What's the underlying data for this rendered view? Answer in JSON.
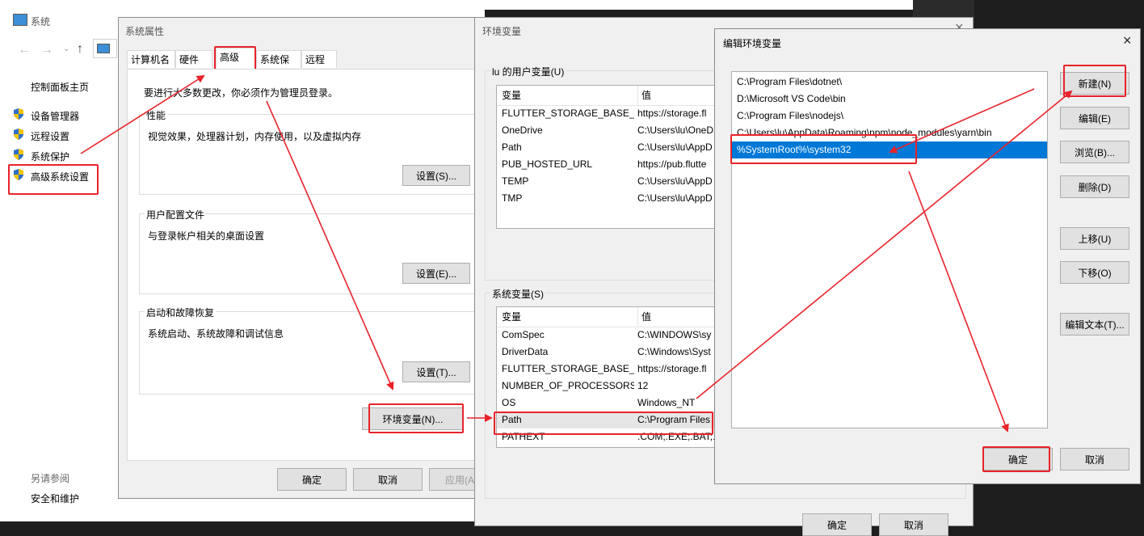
{
  "system_window": {
    "title": "系统",
    "nav_links": {
      "control_panel_home": "控制面板主页",
      "device_manager": "设备管理器",
      "remote_settings": "远程设置",
      "system_protection": "系统保护",
      "advanced_system_settings": "高级系统设置"
    },
    "see_also_label": "另请参阅",
    "security_maintenance": "安全和维护"
  },
  "sys_props": {
    "title": "系统属性",
    "tabs": [
      "计算机名",
      "硬件",
      "高级",
      "系统保护",
      "远程"
    ],
    "admin_note": "要进行大多数更改，你必须作为管理员登录。",
    "performance": {
      "label": "性能",
      "desc": "视觉效果，处理器计划，内存使用，以及虚拟内存",
      "button": "设置(S)..."
    },
    "user_profiles": {
      "label": "用户配置文件",
      "desc": "与登录帐户相关的桌面设置",
      "button": "设置(E)..."
    },
    "startup_recovery": {
      "label": "启动和故障恢复",
      "desc": "系统启动、系统故障和调试信息",
      "button": "设置(T)..."
    },
    "env_vars_button": "环境变量(N)...",
    "ok": "确定",
    "cancel": "取消",
    "apply": "应用(A"
  },
  "env_vars": {
    "title": "环境变量",
    "user_section": "lu 的用户变量(U)",
    "system_section": "系统变量(S)",
    "col_var": "变量",
    "col_val": "值",
    "user_rows": [
      {
        "name": "FLUTTER_STORAGE_BASE_...",
        "value": "https://storage.fl"
      },
      {
        "name": "OneDrive",
        "value": "C:\\Users\\lu\\OneD"
      },
      {
        "name": "Path",
        "value": "C:\\Users\\lu\\AppD"
      },
      {
        "name": "PUB_HOSTED_URL",
        "value": "https://pub.flutte"
      },
      {
        "name": "TEMP",
        "value": "C:\\Users\\lu\\AppD"
      },
      {
        "name": "TMP",
        "value": "C:\\Users\\lu\\AppD"
      }
    ],
    "system_rows": [
      {
        "name": "ComSpec",
        "value": "C:\\WINDOWS\\sy"
      },
      {
        "name": "DriverData",
        "value": "C:\\Windows\\Syst"
      },
      {
        "name": "FLUTTER_STORAGE_BASE_...",
        "value": "https://storage.fl"
      },
      {
        "name": "NUMBER_OF_PROCESSORS",
        "value": "12"
      },
      {
        "name": "OS",
        "value": "Windows_NT"
      },
      {
        "name": "Path",
        "value": "C:\\Program Files"
      },
      {
        "name": "PATHEXT",
        "value": ".COM;.EXE;.BAT;."
      }
    ],
    "ok": "确定",
    "cancel": "取消"
  },
  "edit_env": {
    "title": "编辑环境变量",
    "entries": [
      "C:\\Program Files\\dotnet\\",
      "D:\\Microsoft VS Code\\bin",
      "C:\\Program Files\\nodejs\\",
      "C:\\Users\\lu\\AppData\\Roaming\\npm\\node_modules\\yarn\\bin",
      "%SystemRoot%\\system32"
    ],
    "buttons": {
      "new": "新建(N)",
      "edit": "编辑(E)",
      "browse": "浏览(B)...",
      "delete": "删除(D)",
      "move_up": "上移(U)",
      "move_down": "下移(O)",
      "edit_text": "编辑文本(T)..."
    },
    "ok": "确定",
    "cancel": "取消"
  },
  "colors": {
    "annotation_red": "#e8232a",
    "selection_blue": "#0078d7"
  }
}
